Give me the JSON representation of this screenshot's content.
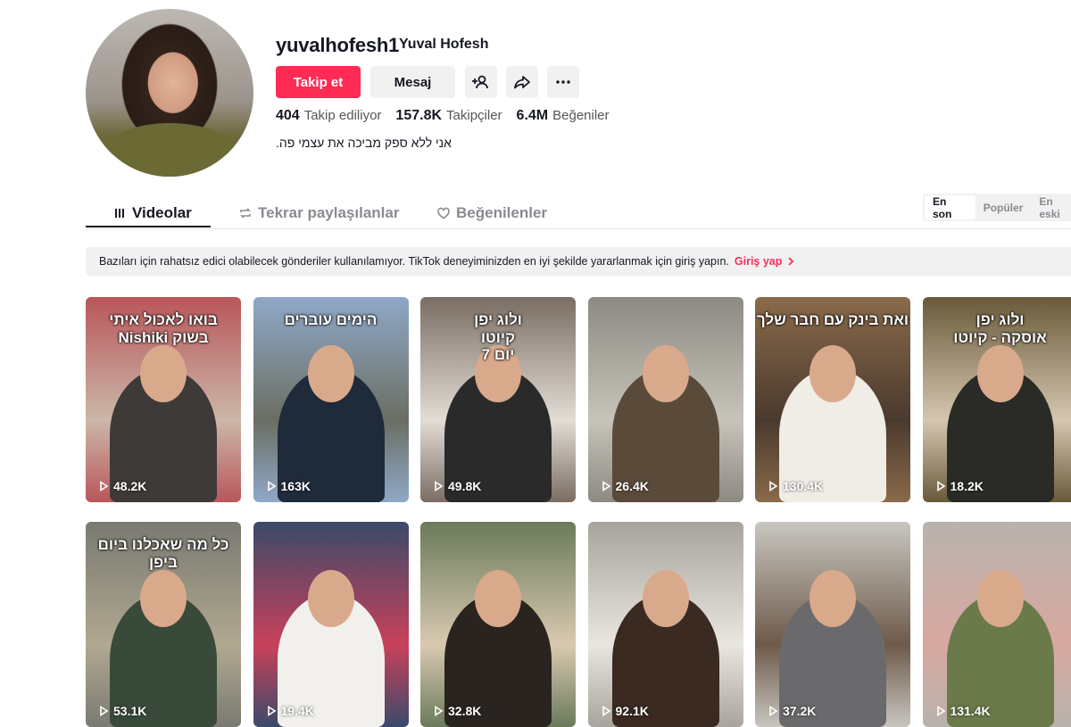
{
  "profile": {
    "username": "yuvalhofesh1",
    "nickname": "Yuval Hofesh",
    "follow_label": "Takip et",
    "message_label": "Mesaj",
    "stats": [
      {
        "value": "404",
        "label": "Takip ediliyor"
      },
      {
        "value": "157.8K",
        "label": "Takipçiler"
      },
      {
        "value": "6.4M",
        "label": "Beğeniler"
      }
    ],
    "bio": "אני ללא ספק מביכה את עצמי פה."
  },
  "tabs": [
    {
      "label": "Videolar",
      "icon": "grid-icon",
      "active": true
    },
    {
      "label": "Tekrar paylaşılanlar",
      "icon": "repost-icon",
      "active": false
    },
    {
      "label": "Beğenilenler",
      "icon": "heart-icon",
      "active": false
    }
  ],
  "sort_options": [
    "En son",
    "Popüler",
    "En eski"
  ],
  "banner": {
    "text": "Bazıları için rahatsız edici olabilecek gönderiler kullanılamıyor. TikTok deneyiminizden en iyi şekilde yararlanmak için giriş yapın.",
    "link": "Giriş yap"
  },
  "videos": [
    {
      "views": "48.2K",
      "caption": "בואו לאכול איתי\nבשוק Nishiki"
    },
    {
      "views": "163K",
      "caption": "הימים עוברים"
    },
    {
      "views": "49.8K",
      "caption": "ולוג יפן\nקיוטו\nיום 7"
    },
    {
      "views": "26.4K",
      "caption": ""
    },
    {
      "views": "130.4K",
      "caption": "ואת בינק עם חבר שלך"
    },
    {
      "views": "18.2K",
      "caption": "ולוג יפן\nאוסקה - קיוטו"
    },
    {
      "views": "53.1K",
      "caption": "כל מה שאכלנו ביום\nביפן"
    },
    {
      "views": "19.4K",
      "caption": ""
    },
    {
      "views": "32.8K",
      "caption": ""
    },
    {
      "views": "92.1K",
      "caption": ""
    },
    {
      "views": "37.2K",
      "caption": ""
    },
    {
      "views": "131.4K",
      "caption": ""
    }
  ],
  "colors": {
    "accent": "#fe2c55",
    "text": "#161823",
    "muted": "#8a8b91"
  }
}
